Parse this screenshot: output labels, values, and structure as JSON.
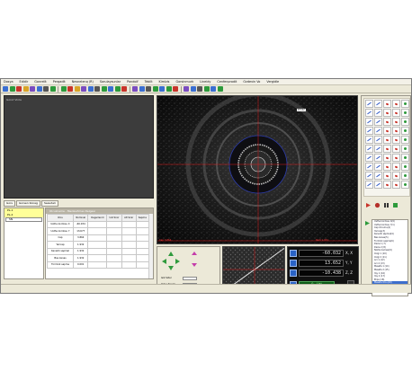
{
  "menubar": {
    "items": [
      "Dosya",
      "Edidir",
      "Gonrelit",
      "Pergadit",
      "Nesnelenq (R)",
      "Sorulaysunlar",
      "Pandolf",
      "Tebilt",
      "Kimlzis",
      "Gorsinmurk",
      "Lineidy",
      "Cenfenprodit",
      "Ozdevin Vo",
      "Vergidle"
    ]
  },
  "viewer": {
    "label": "Gorut Vinla"
  },
  "left_tabs": [
    "Gors",
    "Gorsen Konag",
    "Seevdeli"
  ],
  "tree": {
    "rows": [
      "PL-1",
      "PL-2",
      "SN"
    ]
  },
  "results": {
    "title": "Olcuzneme - Mezlevitmes Delgesi",
    "headers": [
      "Olcu",
      "Nominal",
      "Degerlendi",
      "Ust Sinir",
      "Alt Sinir",
      "Sapma"
    ],
    "rows": [
      [
        "Ustha kordosu X",
        "-60.034",
        "",
        "",
        "",
        ""
      ],
      [
        "Ustha kordosu Y",
        "13.677",
        "",
        "",
        "",
        ""
      ],
      [
        "Cap",
        "3.864",
        "",
        "",
        "",
        ""
      ],
      [
        "Yaricap",
        "1.932",
        "",
        "",
        "",
        ""
      ],
      [
        "Kenarlk sapmal",
        "1.932",
        "",
        "",
        "",
        ""
      ],
      [
        "Bas kanas",
        "1.932",
        "",
        "",
        "",
        ""
      ],
      [
        "Formlok sapma",
        "0.001",
        "",
        "",
        "",
        ""
      ]
    ]
  },
  "camera": {
    "tag": "D3.62",
    "bottom_left": "Cap 3.864",
    "bottom_right": "Radi 1.932"
  },
  "controls": {
    "label1": "Isik Sider",
    "label2": "Yalna Zonali"
  },
  "dro": {
    "x": {
      "value": "-60.032",
      "axis": "X, X"
    },
    "y": {
      "value": "13.652",
      "axis": "Y, Y"
    },
    "z": {
      "value": "-10.438",
      "axis": "Z, Z"
    },
    "status": "0 - Ust"
  },
  "feature_list": {
    "items": [
      "Ustha kordosu X(0)",
      "Ustha kordosu Y(1)",
      "Cap Olcumu(2)",
      "Yaricap(3)",
      "Kenarlk sapmal(4)",
      "Bas kanas(5)",
      "Formlok sapma(6)",
      "Daire 1 (7)",
      "Daire 2 (8)",
      "Nokta kumesi(9)",
      "Cizgi 1 (10)",
      "Cizgi 2 (11)",
      "Aci 1 (12)",
      "Aci 2 (13)",
      "Mesafe 1 (14)",
      "Mesafe 2 (15)",
      "Yay 1 (16)",
      "Yay 2 (17)",
      "Elips (18)",
      "Mesafe Olcu(19)"
    ],
    "selected_index": 19
  },
  "colors": {
    "crosshair": "#e11b1b",
    "overlay_text": "#ff3b3b",
    "dro_button": "#2a63c6",
    "status_green": "#0c5a16"
  },
  "icons": [
    "play-icon",
    "record-icon",
    "pause-icon",
    "export-icon"
  ]
}
